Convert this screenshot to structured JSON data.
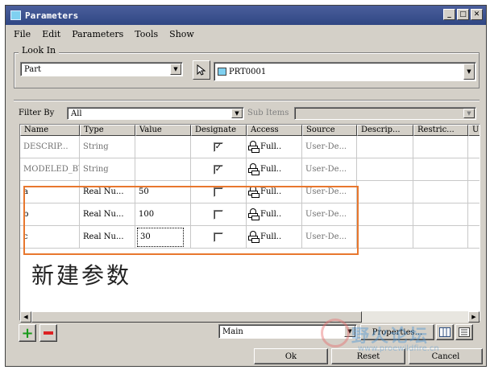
{
  "window": {
    "title": "Parameters"
  },
  "menu": [
    "File",
    "Edit",
    "Parameters",
    "Tools",
    "Show"
  ],
  "look_in": {
    "legend": "Look In",
    "type_value": "Part",
    "object_value": "PRT0001"
  },
  "filter": {
    "label": "Filter By",
    "value": "All",
    "sub_items_label": "Sub Items",
    "sub_items_value": ""
  },
  "table": {
    "headers": [
      "Name",
      "Type",
      "Value",
      "Designate",
      "Access",
      "Source",
      "Descrip...",
      "Restric...",
      "U"
    ],
    "rows": [
      {
        "name": "DESCRIP...",
        "type": "String",
        "value": "",
        "designate": true,
        "access": "Full..",
        "source": "User-De..."
      },
      {
        "name": "MODELED_BY",
        "type": "String",
        "value": "",
        "designate": true,
        "access": "Full..",
        "source": "User-De..."
      },
      {
        "name": "a",
        "type": "Real Nu...",
        "value": "50",
        "designate": false,
        "access": "Full..",
        "source": "User-De..."
      },
      {
        "name": "b",
        "type": "Real Nu...",
        "value": "100",
        "designate": false,
        "access": "Full..",
        "source": "User-De..."
      },
      {
        "name": "c",
        "type": "Real Nu...",
        "value": "30",
        "designate": false,
        "access": "Full..",
        "source": "User-De..."
      }
    ]
  },
  "annotation": "新建参数",
  "bottom": {
    "main_value": "Main",
    "properties_label": "Properties...",
    "ok_label": "Ok",
    "reset_label": "Reset",
    "cancel_label": "Cancel"
  },
  "watermark": {
    "cn": "野火论坛",
    "url": "www.proewildfire.cn"
  },
  "colors": {
    "highlight": "#e8772e",
    "title_bar": "#2f4683"
  },
  "icons": {
    "add": "plus-icon",
    "remove": "minus-icon",
    "lock": "lock-icon",
    "select": "cursor-icon"
  }
}
